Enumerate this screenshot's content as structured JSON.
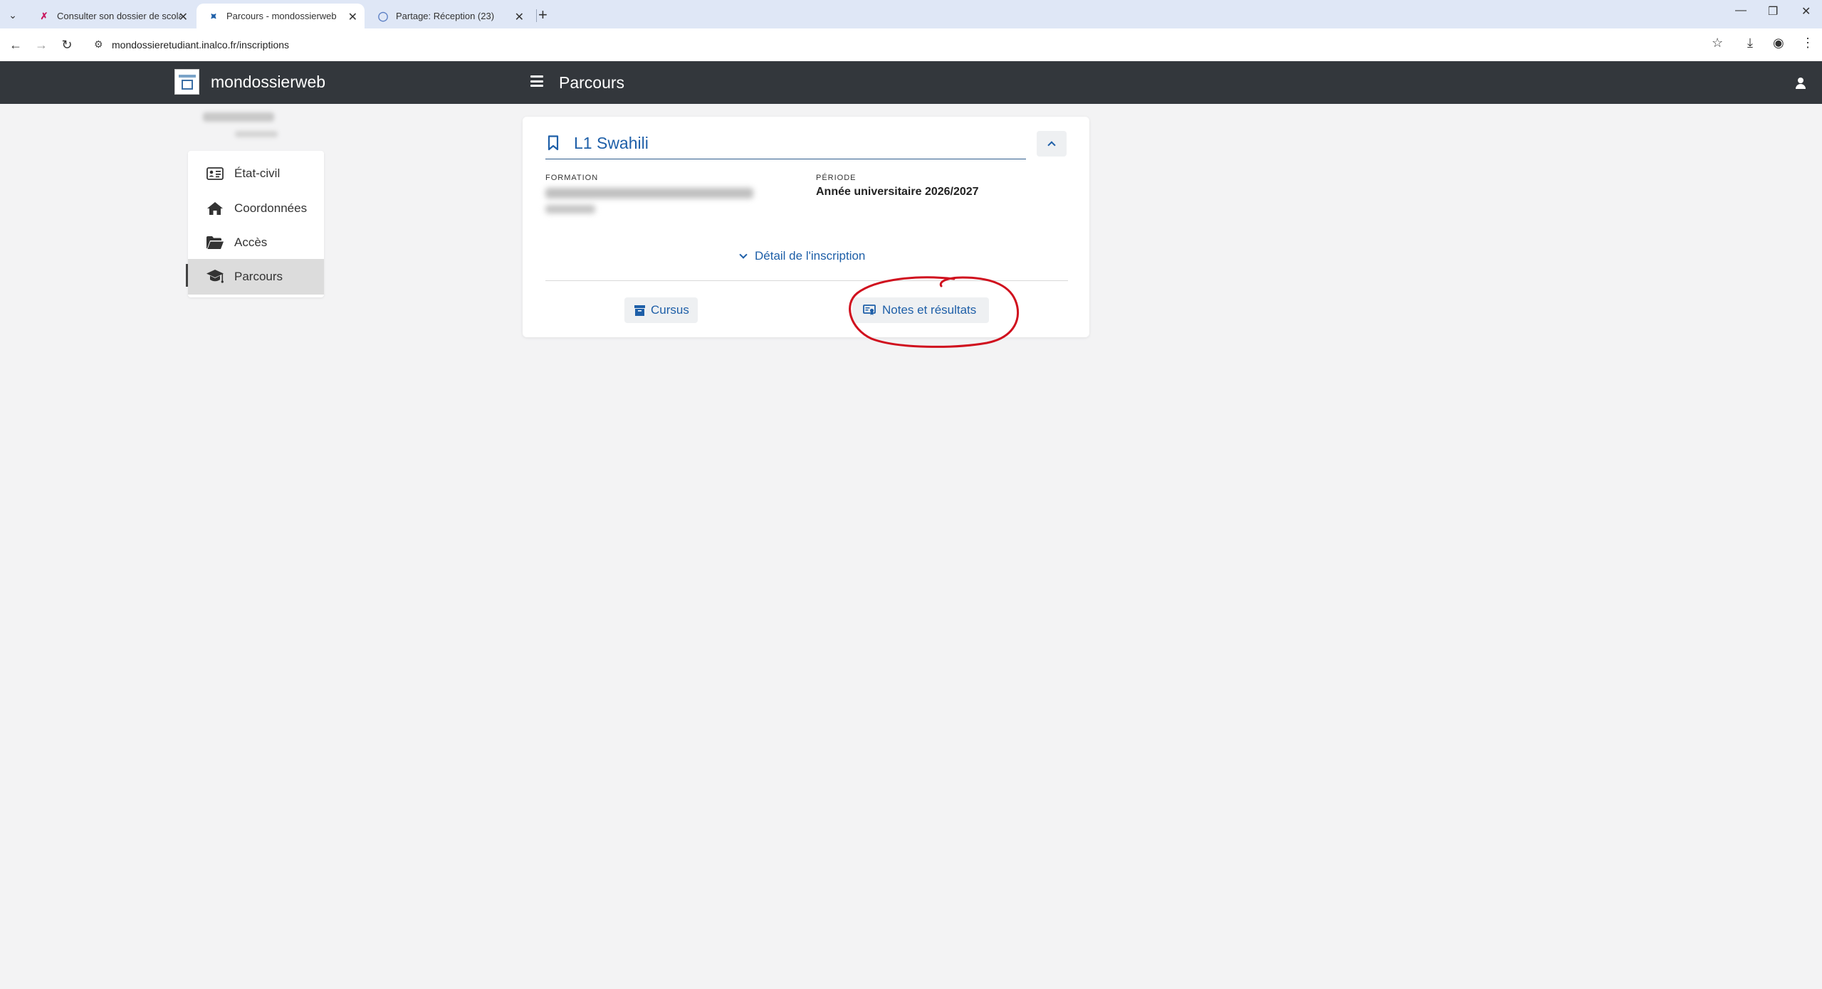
{
  "browser": {
    "tabs": [
      {
        "title": "Consulter son dossier de scolarit",
        "active": false
      },
      {
        "title": "Parcours - mondossierweb",
        "active": true
      },
      {
        "title": "Partage: Réception (23)",
        "active": false
      }
    ],
    "url": "mondossieretudiant.inalco.fr/inscriptions"
  },
  "header": {
    "brand": "mondossierweb",
    "page_title": "Parcours"
  },
  "sidebar": {
    "items": [
      {
        "label": "État-civil",
        "icon": "id-card-icon"
      },
      {
        "label": "Coordonnées",
        "icon": "home-icon"
      },
      {
        "label": "Accès",
        "icon": "folder-open-icon"
      },
      {
        "label": "Parcours",
        "icon": "graduation-cap-icon",
        "active": true
      }
    ]
  },
  "inscription": {
    "title": "L1 Swahili",
    "formation_label": "FORMATION",
    "periode_label": "PÉRIODE",
    "periode_value": "Année universitaire 2026/2027",
    "detail_link": "Détail de l'inscription",
    "cursus_button": "Cursus",
    "notes_button": "Notes et résultats"
  },
  "colors": {
    "accent": "#1e5fa8",
    "appbar": "#33373c",
    "background": "#f3f3f4",
    "annotation": "#d0101e"
  }
}
